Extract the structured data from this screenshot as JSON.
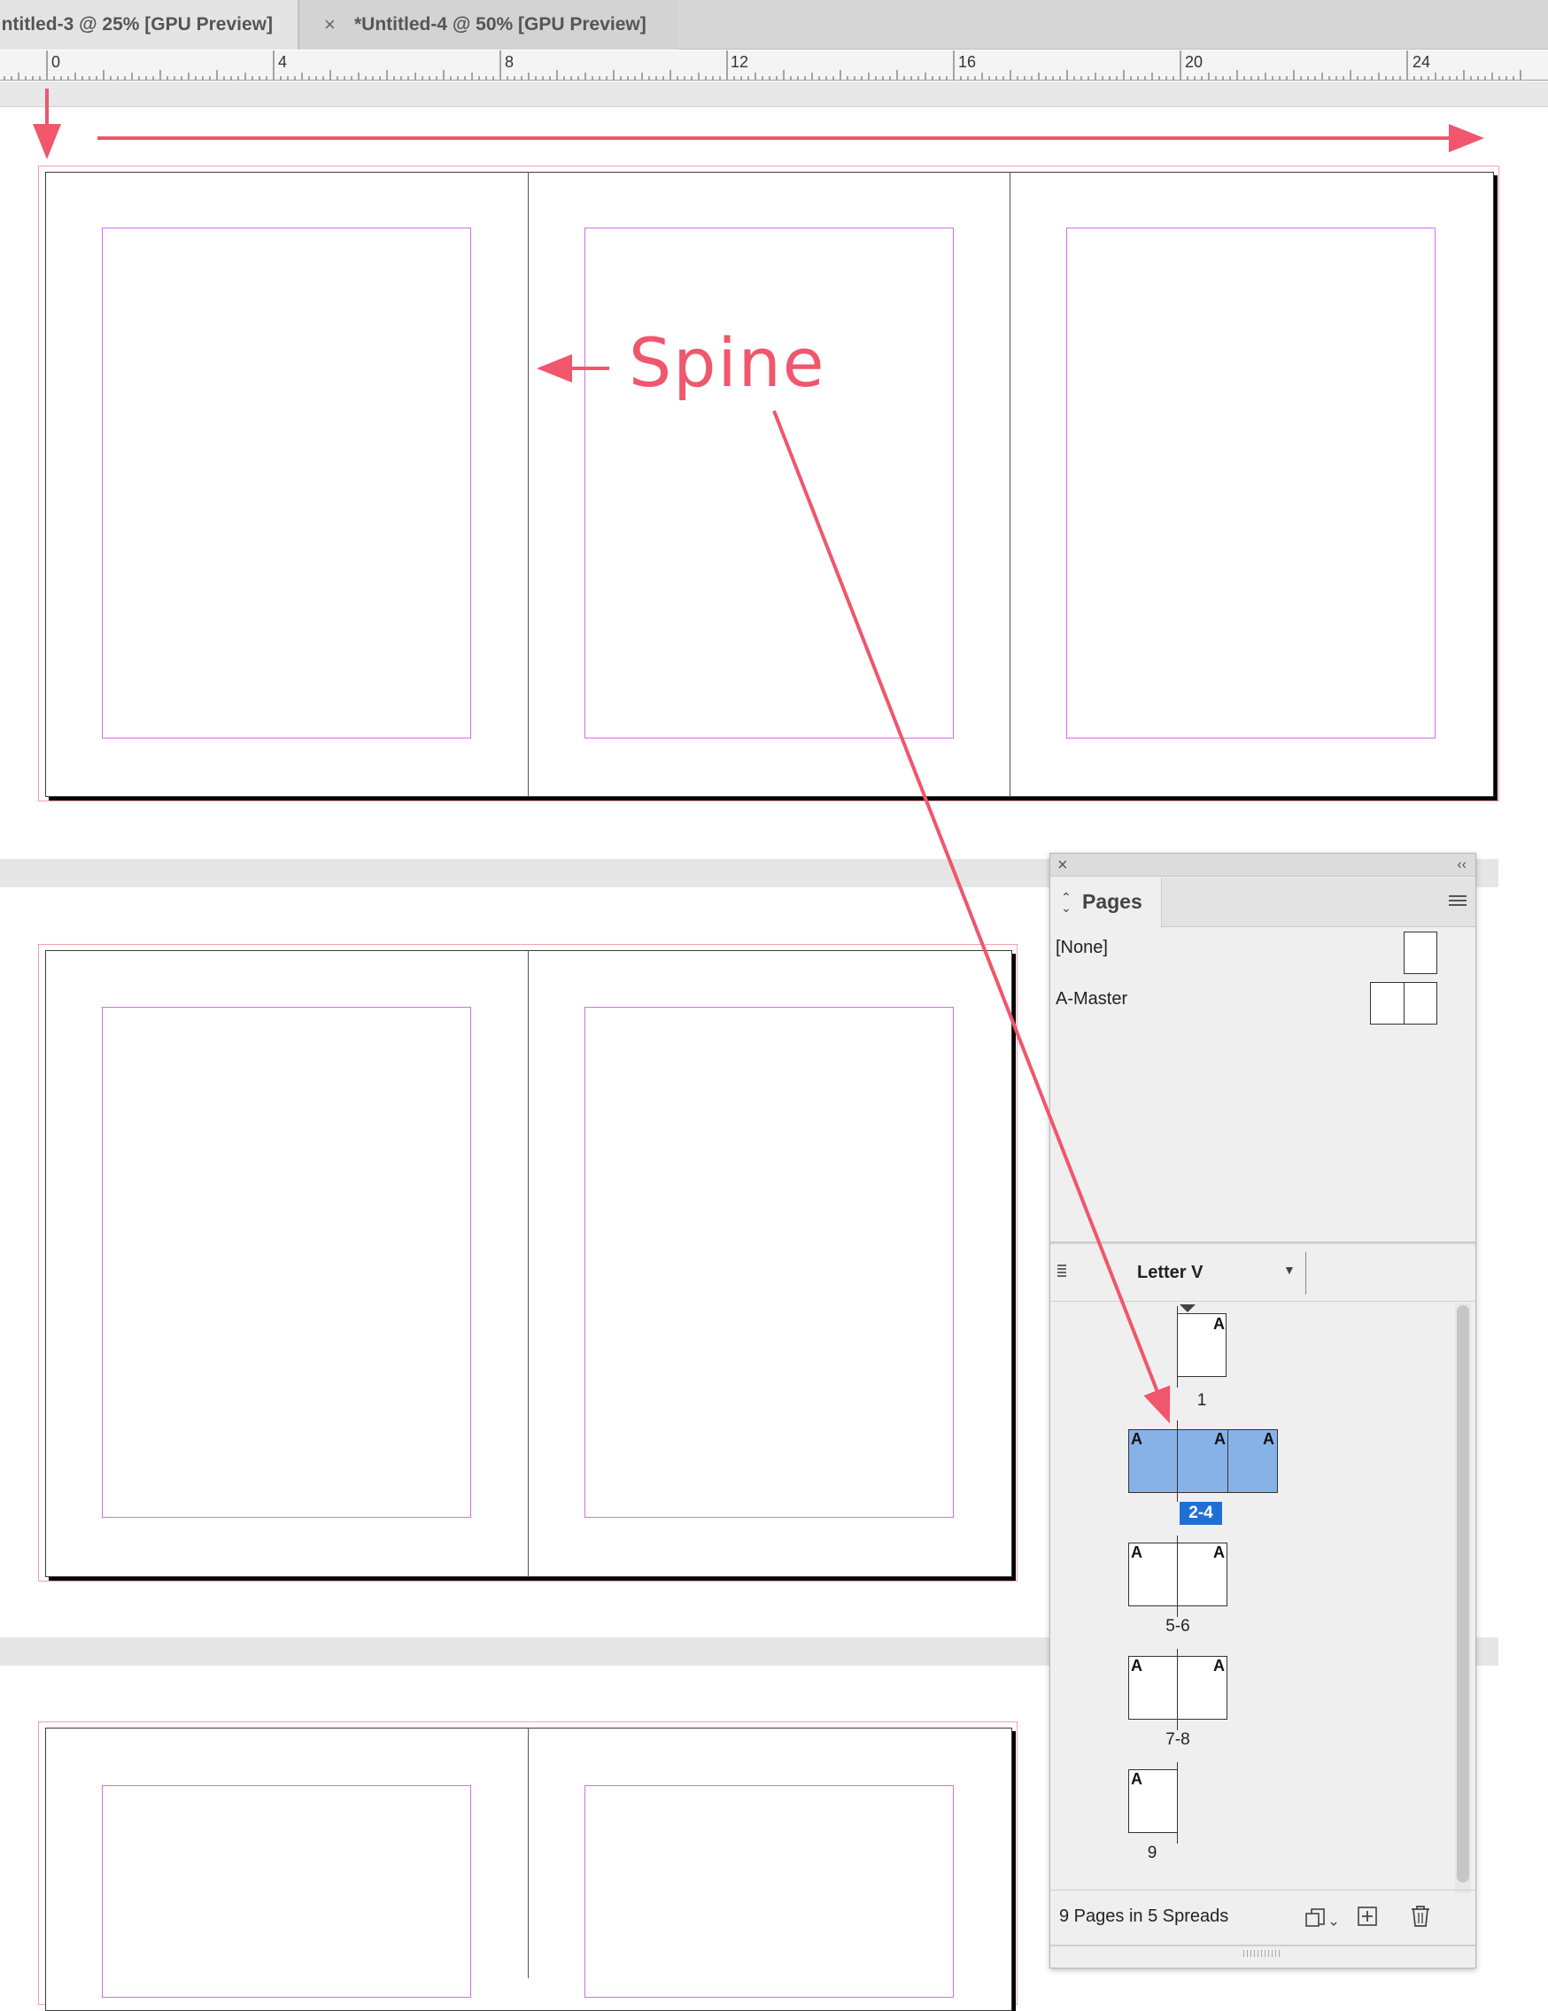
{
  "tabs": [
    {
      "label": "ntitled-3 @ 25% [GPU Preview]"
    },
    {
      "close": "×",
      "label": "*Untitled-4 @ 50% [GPU Preview]"
    }
  ],
  "ruler": {
    "numbers": [
      "0",
      "4",
      "8",
      "12",
      "16",
      "20",
      "24"
    ]
  },
  "annotation": {
    "spine_label": "Spine",
    "arrow_color": "#f0566c"
  },
  "pages_panel": {
    "close": "×",
    "collapse": "‹‹",
    "tab_label": "Pages",
    "masters": [
      {
        "label": "[None]"
      },
      {
        "label": "A-Master"
      }
    ],
    "page_size": "Letter V",
    "master_prefix": "A",
    "spreads": [
      {
        "label": "1",
        "selected": false
      },
      {
        "label": "2-4",
        "selected": true
      },
      {
        "label": "5-6",
        "selected": false
      },
      {
        "label": "7-8",
        "selected": false
      },
      {
        "label": "9",
        "selected": false
      }
    ],
    "footer_text": "9 Pages in 5 Spreads"
  },
  "colors": {
    "bleed_guide": "#f4a0a8",
    "margin_guide": "#d66bf2",
    "selection": "#86b2e8",
    "selected_label_bg": "#1f6fd6"
  }
}
